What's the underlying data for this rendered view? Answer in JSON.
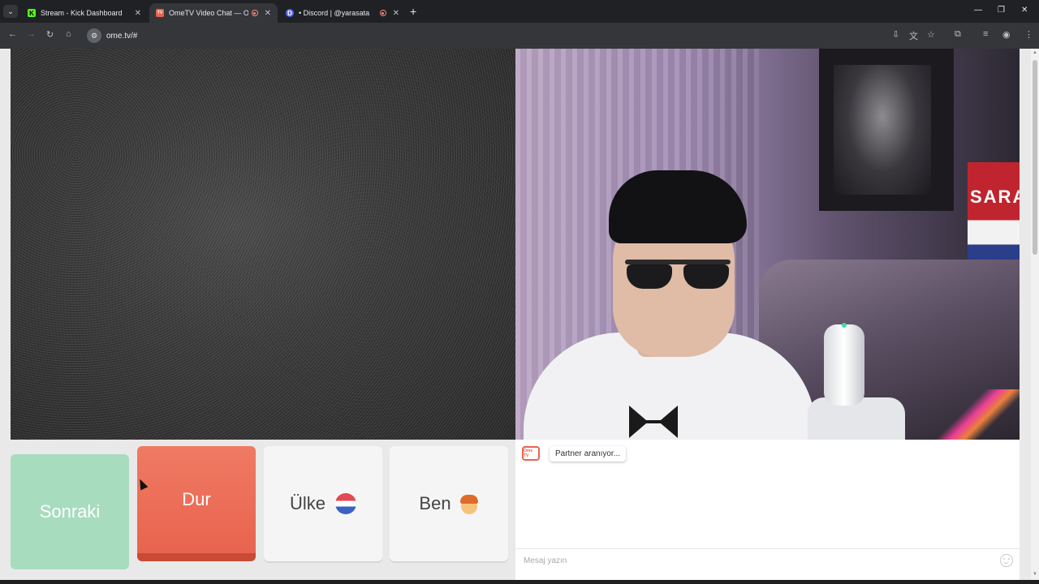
{
  "browser": {
    "tabs": [
      {
        "title": "Stream - Kick Dashboard",
        "favicon": "K",
        "color": "#53fc18",
        "active": false
      },
      {
        "title": "OmeTV Video Chat — Ome",
        "favicon": "TV",
        "color": "#e8644e",
        "active": true,
        "recording": true
      },
      {
        "title": "• Discord | @yarasata",
        "favicon": "D",
        "color": "#5865f2",
        "active": false,
        "recording": true
      }
    ],
    "url": "ome.tv/#"
  },
  "buttons": {
    "next": "Sonraki",
    "stop": "Dur",
    "country": "Ülke",
    "me": "Ben"
  },
  "chat": {
    "status_message": "Partner aranıyor...",
    "input_placeholder": "Mesaj yazın",
    "logo_text": "Ome TV"
  },
  "overlay": {
    "flag_text": "SARAY"
  },
  "colors": {
    "next": "#a7dcbf",
    "stop": "#e8644e",
    "neutral": "#f5f5f5"
  }
}
